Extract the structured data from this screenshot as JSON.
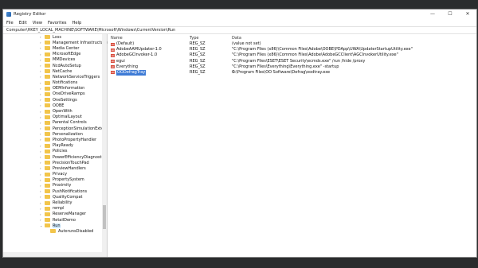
{
  "window": {
    "title": "Registry Editor",
    "controls": {
      "minimize": "—",
      "maximize": "☐",
      "close": "✕"
    }
  },
  "menu": [
    "File",
    "Edit",
    "View",
    "Favorites",
    "Help"
  ],
  "address": "Computer\\HKEY_LOCAL_MACHINE\\SOFTWARE\\Microsoft\\Windows\\CurrentVersion\\Run",
  "tree": [
    "Lxss",
    "Management Infrastructure",
    "Media Center",
    "MicrosoftEdge",
    "MMDevices",
    "NcdAutoSetup",
    "NetCache",
    "NetworkServiceTriggers",
    "Notifications",
    "OEMInformation",
    "OneDriveRamps",
    "OneSettings",
    "OOBE",
    "OpenWith",
    "OptimalLayout",
    "Parental Controls",
    "PerceptionSimulationExten",
    "Personalization",
    "PhotoPropertyHandler",
    "PlayReady",
    "Policies",
    "PowerEfficiencyDiagnostic",
    "PrecisionTouchPad",
    "PreviewHandlers",
    "Privacy",
    "PropertySystem",
    "Proximity",
    "PushNotifications",
    "QualityCompat",
    "Reliability",
    "rempl",
    "ReserveManager",
    "RetailDemo",
    "Run",
    "AutorunsDisabled"
  ],
  "columns": {
    "name": "Name",
    "type": "Type",
    "data": "Data"
  },
  "values": [
    {
      "name": "(Default)",
      "type": "REG_SZ",
      "data": "(value not set)"
    },
    {
      "name": "AdobeAAMUpdater-1.0",
      "type": "REG_SZ",
      "data": "\"C:\\Program Files (x86)\\Common Files\\Adobe\\OOBE\\PDApp\\UWA\\UpdaterStartupUtility.exe\""
    },
    {
      "name": "AdobeGCInvoker-1.0",
      "type": "REG_SZ",
      "data": "\"C:\\Program Files (x86)\\Common Files\\Adobe\\AdobeGCClient\\AGCInvokerUtility.exe\""
    },
    {
      "name": "egui",
      "type": "REG_SZ",
      "data": "\"C:\\Program Files\\ESET\\ESET Security\\ecmds.exe\" /run /hide /proxy"
    },
    {
      "name": "Everything",
      "type": "REG_SZ",
      "data": "\"C:\\Program Files\\Everything\\Everything.exe\" -startup"
    },
    {
      "name": "OODefragTray",
      "type": "REG_SZ",
      "data": "C:\\Program Files\\OO Software\\Defrag\\oodtray.exe"
    }
  ]
}
